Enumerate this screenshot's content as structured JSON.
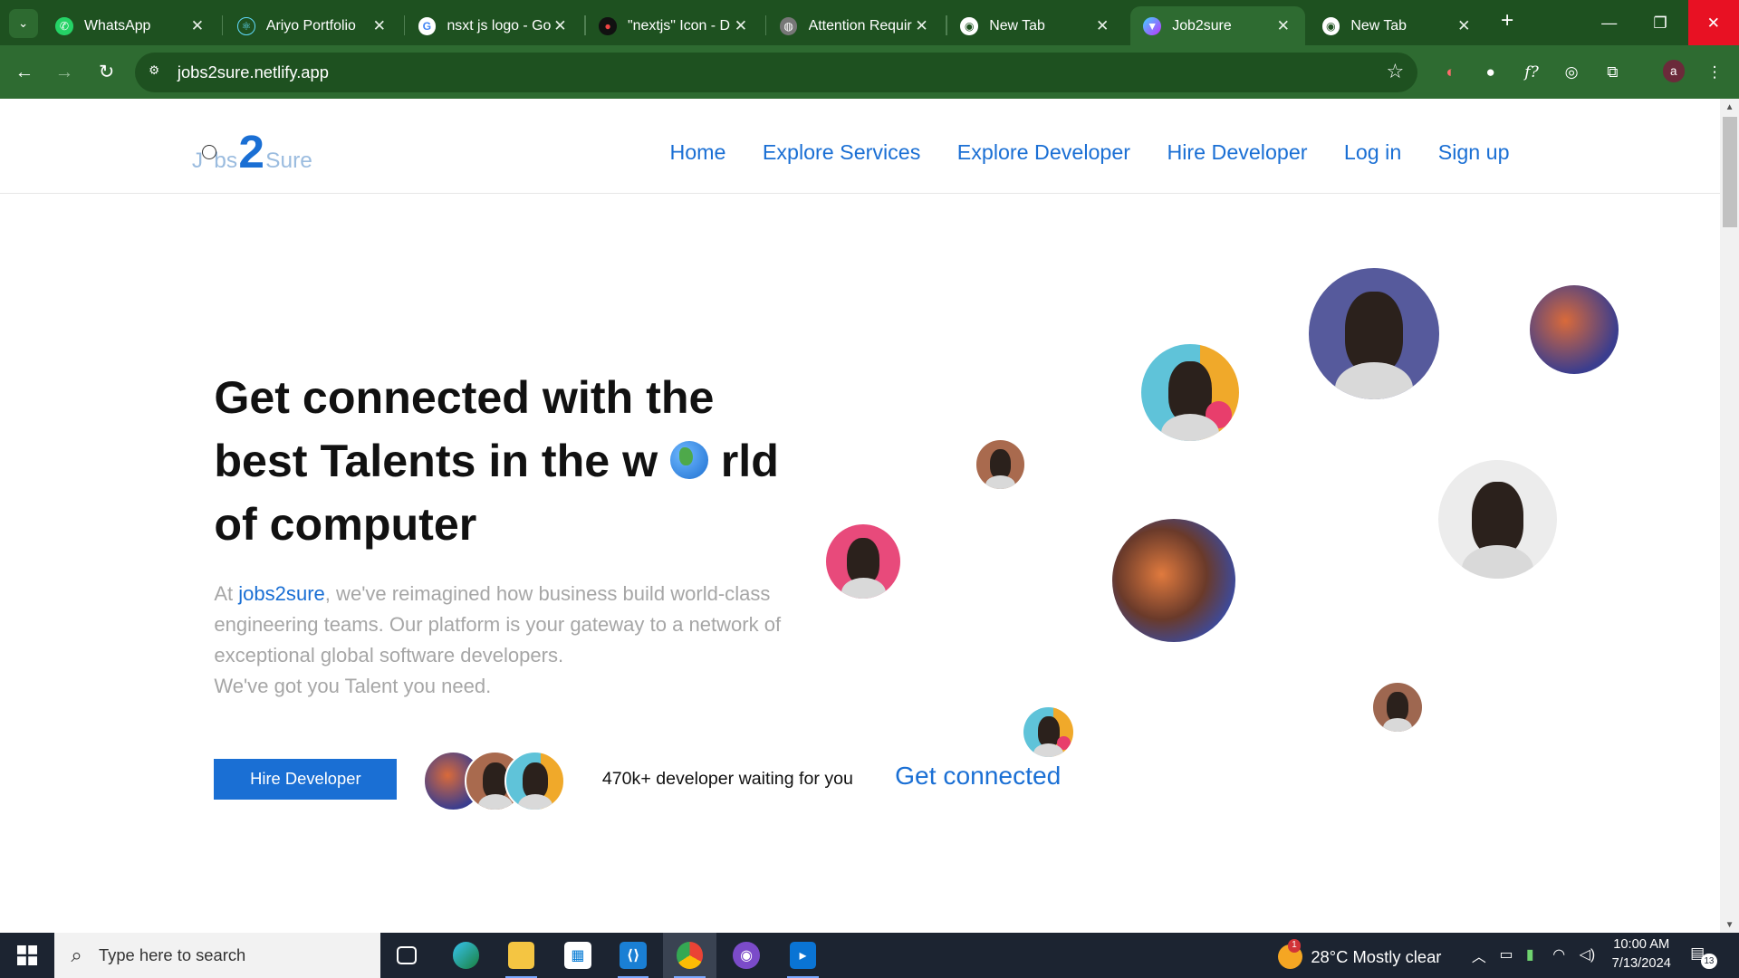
{
  "browser": {
    "tabs": [
      {
        "title": "WhatsApp",
        "icon": "whatsapp-icon",
        "color": "#25d366"
      },
      {
        "title": "Ariyo Portfolio",
        "icon": "react-icon",
        "color": "#61dafb"
      },
      {
        "title": "nsxt js logo - Go",
        "icon": "google-icon",
        "color": "#ffffff"
      },
      {
        "title": "\"nextjs\" Icon - D",
        "icon": "devil-icon",
        "color": "#111111"
      },
      {
        "title": "Attention Requir",
        "icon": "globe-icon",
        "color": "#888888"
      },
      {
        "title": "New Tab",
        "icon": "chrome-icon",
        "color": "#ffffff"
      },
      {
        "title": "Job2sure",
        "icon": "vite-icon",
        "color": "#a15cff",
        "active": true
      },
      {
        "title": "New Tab",
        "icon": "chrome-icon",
        "color": "#ffffff"
      }
    ],
    "url": "jobs2sure.netlify.app",
    "profile_initial": "a"
  },
  "site": {
    "logo": {
      "left": "J",
      "middle": "bs",
      "big": "2",
      "right": "Sure"
    },
    "nav": [
      "Home",
      "Explore Services",
      "Explore Developer",
      "Hire Developer",
      "Log in",
      "Sign up"
    ],
    "hero": {
      "title_line1": "Get connected with the",
      "title_line2_a": "best Talents in the w",
      "title_line2_b": "rld",
      "title_line3": "of computer",
      "desc_prefix": "At ",
      "desc_brand": "jobs2sure",
      "desc_body": ", we've reimagined how business build world-class engineering teams. Our platform is your gateway to a network of exceptional global software developers.",
      "desc_line2": "We've got you Talent you need."
    },
    "cta": {
      "button": "Hire Developer",
      "waiting": "470k+ developer waiting for you",
      "link": "Get connected"
    }
  },
  "taskbar": {
    "search_placeholder": "Type here to search",
    "weather": "28°C  Mostly clear",
    "weather_badge": "1",
    "time": "10:00 AM",
    "date": "7/13/2024",
    "notifications": "13"
  },
  "colors": {
    "accent": "#1a6fd4",
    "browser_frame": "#2e6b31",
    "taskbar": "#1c2431"
  }
}
